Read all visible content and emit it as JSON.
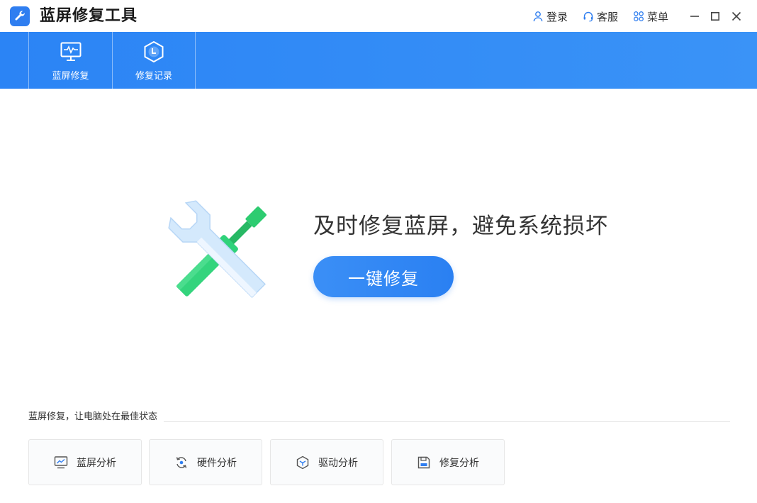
{
  "app": {
    "title": "蓝屏修复工具"
  },
  "titlebar": {
    "login_label": "登录",
    "service_label": "客服",
    "menu_label": "菜单"
  },
  "nav": {
    "tabs": [
      {
        "label": "蓝屏修复",
        "icon": "monitor-pulse-icon",
        "active": true
      },
      {
        "label": "修复记录",
        "icon": "hexagon-clock-icon",
        "active": false
      }
    ]
  },
  "hero": {
    "headline": "及时修复蓝屏，避免系统损坏",
    "button_label": "一键修复",
    "illustration": "wrench-screwdriver-icon"
  },
  "section": {
    "caption": "蓝屏修复，让电脑处在最佳状态",
    "cards": [
      {
        "label": "蓝屏分析",
        "icon": "monitor-chart-icon"
      },
      {
        "label": "硬件分析",
        "icon": "cycle-arrows-icon"
      },
      {
        "label": "驱动分析",
        "icon": "cube-icon"
      },
      {
        "label": "修复分析",
        "icon": "floppy-disk-icon"
      }
    ]
  },
  "colors": {
    "brand_blue": "#2f7ef0",
    "nav_blue": "#2b84f5",
    "accent_green": "#2ecc71",
    "icon_gray": "#555555"
  }
}
